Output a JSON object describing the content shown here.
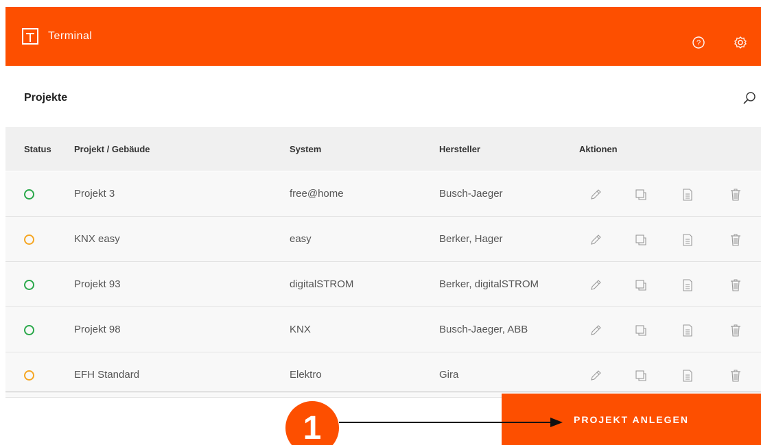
{
  "header": {
    "app_name": "Terminal",
    "help_icon": "help-circle-icon",
    "settings_icon": "gear-icon",
    "brand_color": "#fd4f00"
  },
  "page": {
    "title": "Projekte",
    "search_icon": "search-icon"
  },
  "table": {
    "columns": [
      "Status",
      "Projekt / Gebäude",
      "System",
      "Hersteller",
      "Aktionen"
    ],
    "rows": [
      {
        "status": "green",
        "project": "Projekt 3",
        "system": "free@home",
        "manufacturer": "Busch-Jaeger"
      },
      {
        "status": "orange",
        "project": "KNX easy",
        "system": "easy",
        "manufacturer": "Berker, Hager"
      },
      {
        "status": "green",
        "project": "Projekt 93",
        "system": "digitalSTROM",
        "manufacturer": "Berker, digitalSTROM"
      },
      {
        "status": "green",
        "project": "Projekt 98",
        "system": "KNX",
        "manufacturer": "Busch-Jaeger, ABB"
      },
      {
        "status": "orange",
        "project": "EFH Standard",
        "system": "Elektro",
        "manufacturer": "Gira"
      }
    ],
    "action_icons": [
      "edit-pencil-icon",
      "duplicate-icon",
      "document-icon",
      "trash-icon"
    ],
    "status_colors": {
      "green": "#2aa84a",
      "orange": "#f5a623"
    }
  },
  "cta": {
    "label": "PROJEKT ANLEGEN"
  },
  "annotation": {
    "step_number": "1"
  }
}
